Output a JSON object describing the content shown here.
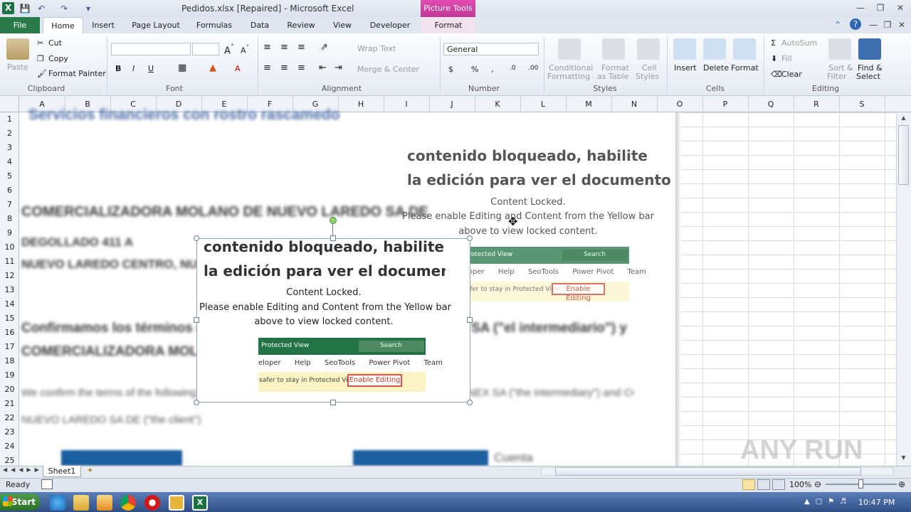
{
  "window": {
    "title": "Pedidos.xlsx [Repaired]  -  Microsoft Excel",
    "contextual_tab": "Picture Tools"
  },
  "tabs": [
    "File",
    "Home",
    "Insert",
    "Page Layout",
    "Formulas",
    "Data",
    "Review",
    "View",
    "Developer",
    "Format"
  ],
  "ribbon": {
    "clipboard": {
      "paste": "Paste",
      "cut": "Cut",
      "copy": "Copy",
      "format_painter": "Format Painter",
      "label": "Clipboard"
    },
    "font": {
      "label": "Font"
    },
    "alignment": {
      "wrap": "Wrap Text",
      "merge": "Merge & Center",
      "label": "Alignment"
    },
    "number": {
      "format": "General",
      "label": "Number"
    },
    "styles": {
      "cond1": "Conditional",
      "cond2": "Formatting",
      "fmt1": "Format",
      "fmt2": "as Table",
      "cell1": "Cell",
      "cell2": "Styles",
      "label": "Styles"
    },
    "cells": {
      "insert": "Insert",
      "delete": "Delete",
      "format": "Format",
      "label": "Cells"
    },
    "editing": {
      "autosum": "AutoSum",
      "fill": "Fill",
      "clear": "Clear",
      "sort1": "Sort &",
      "sort2": "Filter",
      "find1": "Find &",
      "find2": "Select",
      "label": "Editing"
    }
  },
  "columns": [
    "A",
    "B",
    "C",
    "D",
    "E",
    "F",
    "G",
    "H",
    "I",
    "J",
    "K",
    "L",
    "M",
    "N",
    "O",
    "P",
    "Q",
    "R",
    "S"
  ],
  "rows": [
    "1",
    "2",
    "3",
    "4",
    "5",
    "6",
    "7",
    "8",
    "9",
    "10",
    "11",
    "12",
    "13",
    "14",
    "15",
    "16",
    "17",
    "18",
    "19",
    "20",
    "21",
    "22",
    "23",
    "24",
    "25"
  ],
  "doc": {
    "blurred_top": "Servicios financieros con rostro rascamedo",
    "company": "COMERCIALIZADORA MOLANO DE NUEVO LAREDO SA DE",
    "addr1": "DEGOLLADO 411 A",
    "addr2": "NUEVO LAREDO CENTRO, NUEVO",
    "confirm1": "Confirmamos los términos de la siguiente",
    "confirm1b": "SA (\"el intermediario\") y",
    "confirm2": "COMERCIALIZADORA MOLANO DE",
    "eng1": "We confirm the terms of the following foreign exchange transaction between FINANCIERA MONEX SA (\"the intermediary\") and COMERCIALIZADORA MOLANO DE",
    "eng2": "NUEVO LAREDO SA DE (\"the client\")",
    "bottom_right": "Cuenta"
  },
  "locked_bg": {
    "h1": "contenido bloqueado, habilite",
    "h2": "la edición para ver el documento",
    "l1": "Content Locked.",
    "l2": "Please enable Editing and Content from the Yellow bar",
    "l3": "above to view locked content.",
    "pv": "Protected View",
    "search": "Search",
    "menu": [
      "eloper",
      "Help",
      "SeoTools",
      "Power Pivot",
      "Team"
    ],
    "safer": "safer to stay in Protected View.",
    "enable": "Enable Editing"
  },
  "locked_fg": {
    "h1": "contenido bloqueado, habilite",
    "h2": "la edición para ver el documento",
    "l1": "Content Locked.",
    "l2": "Please enable Editing and Content from the Yellow bar",
    "l3": "above to view locked content.",
    "pv": "Protected View",
    "search": "Search",
    "menu": [
      "eloper",
      "Help",
      "SeoTools",
      "Power Pivot",
      "Team"
    ],
    "safer": "safer to stay in Protected View.",
    "enable": "Enable Editing"
  },
  "sheet": {
    "tab": "Sheet1"
  },
  "status": {
    "ready": "Ready",
    "zoom": "100%"
  },
  "taskbar": {
    "start": "Start",
    "time": "10:47 PM"
  },
  "watermark": "ANY RUN"
}
